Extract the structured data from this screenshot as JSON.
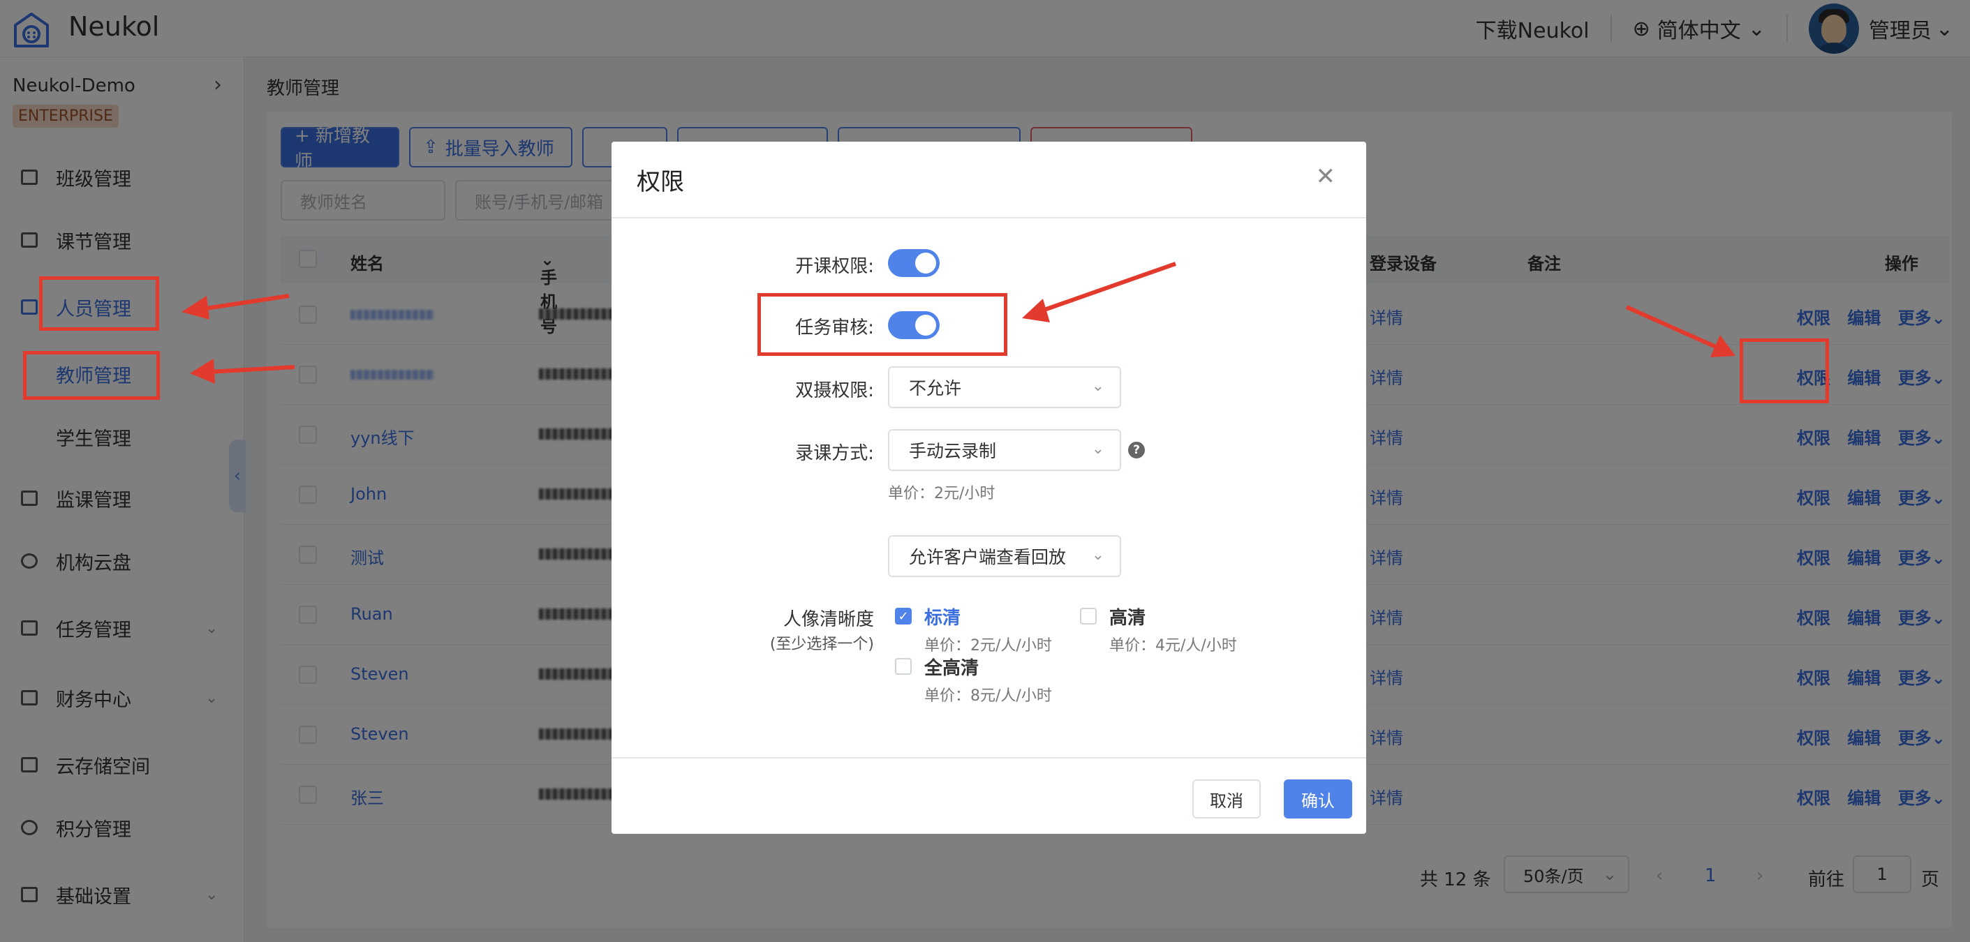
{
  "header": {
    "brand": "Neukol",
    "download": "下载Neukol",
    "language": "简体中文",
    "user": "管理员"
  },
  "sidebar": {
    "org_name": "Neukol-Demo",
    "badge": "ENTERPRISE",
    "items": [
      {
        "label": "班级管理"
      },
      {
        "label": "课节管理"
      },
      {
        "label": "人员管理"
      },
      {
        "label": "教师管理"
      },
      {
        "label": "学生管理"
      },
      {
        "label": "监课管理"
      },
      {
        "label": "机构云盘"
      },
      {
        "label": "任务管理"
      },
      {
        "label": "财务中心"
      },
      {
        "label": "云存储空间"
      },
      {
        "label": "积分管理"
      },
      {
        "label": "基础设置"
      }
    ]
  },
  "main": {
    "breadcrumb": "教师管理",
    "add_button": "+ 新增教师",
    "import_button": "批量导入教师",
    "filter_name_placeholder": "教师姓名",
    "filter_account_placeholder": "账号/手机号/邮箱",
    "table": {
      "headers": {
        "name": "姓名",
        "phone": "手机号",
        "device": "登录设备",
        "remark": "备注",
        "actions": "操作"
      },
      "rows": [
        {
          "name": ""
        },
        {
          "name": ""
        },
        {
          "name": "yyn线下"
        },
        {
          "name": "John"
        },
        {
          "name": "测试"
        },
        {
          "name": "Ruan"
        },
        {
          "name": "Steven"
        },
        {
          "name": "Steven"
        },
        {
          "name": "张三"
        }
      ],
      "detail_text": "详情",
      "action_perm": "权限",
      "action_edit": "编辑",
      "action_more": "更多"
    },
    "pagination": {
      "total": "共 12 条",
      "page_size": "50条/页",
      "current_page": "1",
      "goto_label": "前往",
      "goto_value": "1",
      "page_unit": "页"
    }
  },
  "modal": {
    "title": "权限",
    "fields": {
      "open_class_label": "开课权限:",
      "task_review_label": "任务审核:",
      "dual_camera_label": "双摄权限:",
      "dual_camera_value": "不允许",
      "record_mode_label": "录课方式:",
      "record_mode_value": "手动云录制",
      "record_price_hint": "单价：2元/小时",
      "playback_value": "允许客户端查看回放",
      "clarity_label": "人像清晰度",
      "clarity_sub": "(至少选择一个)",
      "opt_sd": "标清",
      "opt_sd_price": "单价：2元/人/小时",
      "opt_hd": "高清",
      "opt_hd_price": "单价：4元/人/小时",
      "opt_fhd": "全高清",
      "opt_fhd_price": "单价：8元/人/小时"
    },
    "cancel": "取消",
    "confirm": "确认"
  }
}
